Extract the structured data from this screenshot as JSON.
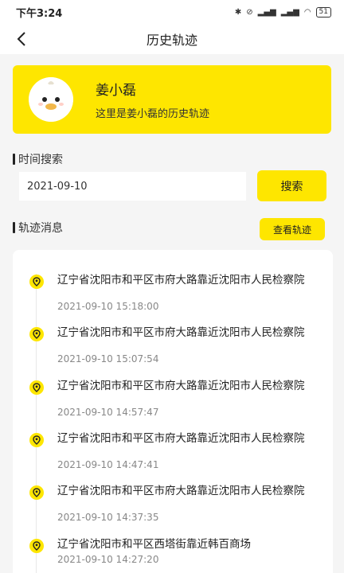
{
  "status_bar": {
    "time": "下午3:24",
    "battery": "51"
  },
  "nav": {
    "title": "历史轨迹"
  },
  "profile": {
    "name": "姜小磊",
    "description": "这里是姜小磊的历史轨迹"
  },
  "time_search": {
    "label": "时间搜索",
    "date_value": "2021-09-10",
    "search_label": "搜索"
  },
  "track": {
    "label": "轨迹消息",
    "view_label": "查看轨迹",
    "items": [
      {
        "address": "辽宁省沈阳市和平区市府大路靠近沈阳市人民检察院",
        "time": "2021-09-10 15:18:00"
      },
      {
        "address": "辽宁省沈阳市和平区市府大路靠近沈阳市人民检察院",
        "time": "2021-09-10 15:07:54"
      },
      {
        "address": "辽宁省沈阳市和平区市府大路靠近沈阳市人民检察院",
        "time": "2021-09-10 14:57:47"
      },
      {
        "address": "辽宁省沈阳市和平区市府大路靠近沈阳市人民检察院",
        "time": "2021-09-10 14:47:41"
      },
      {
        "address": "辽宁省沈阳市和平区市府大路靠近沈阳市人民检察院",
        "time": "2021-09-10 14:37:35"
      },
      {
        "address": "辽宁省沈阳市和平区西塔街靠近韩百商场",
        "time": "2021-09-10 14:27:20"
      }
    ]
  },
  "colors": {
    "accent": "#fee600",
    "background": "#f5f5f5"
  }
}
